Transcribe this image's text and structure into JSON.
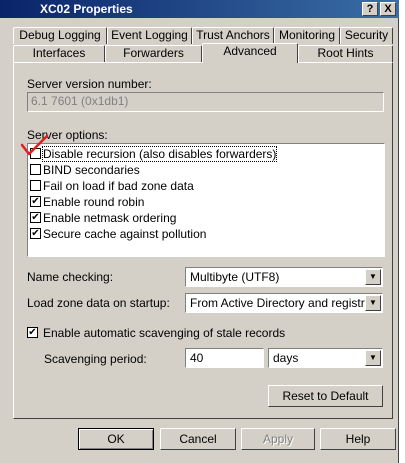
{
  "window": {
    "title": "XC02 Properties",
    "help_glyph": "?",
    "close_glyph": "X"
  },
  "tabs": {
    "row1": [
      "Debug Logging",
      "Event Logging",
      "Trust Anchors",
      "Monitoring",
      "Security"
    ],
    "row2": [
      "Interfaces",
      "Forwarders",
      "Advanced",
      "Root Hints"
    ],
    "selected": "Advanced"
  },
  "advanced": {
    "server_version_label": "Server version number:",
    "server_version_value": "6.1 7601 (0x1db1)",
    "server_options_label": "Server options:",
    "server_options": [
      {
        "label": "Disable recursion (also disables forwarders)",
        "checked": false
      },
      {
        "label": "BIND secondaries",
        "checked": false
      },
      {
        "label": "Fail on load if bad zone data",
        "checked": false
      },
      {
        "label": "Enable round robin",
        "checked": true
      },
      {
        "label": "Enable netmask ordering",
        "checked": true
      },
      {
        "label": "Secure cache against pollution",
        "checked": true
      }
    ],
    "name_checking_label": "Name checking:",
    "name_checking_value": "Multibyte (UTF8)",
    "load_zone_label": "Load zone data on startup:",
    "load_zone_value": "From Active Directory and registry",
    "scavenging_label": "Enable automatic scavenging of stale records",
    "scavenging_checked": true,
    "scavenging_period_label": "Scavenging period:",
    "scavenging_period_value": "40",
    "scavenging_unit": "days",
    "reset_button": "Reset to Default"
  },
  "buttons": {
    "ok": "OK",
    "cancel": "Cancel",
    "apply": "Apply",
    "help": "Help"
  },
  "glyphs": {
    "checkmark": "✔",
    "dropdown_arrow": "▼"
  },
  "colors": {
    "title_bar": "#0a246a",
    "dialog_face": "#d4d0c8",
    "annotation_check": "#e02020"
  }
}
